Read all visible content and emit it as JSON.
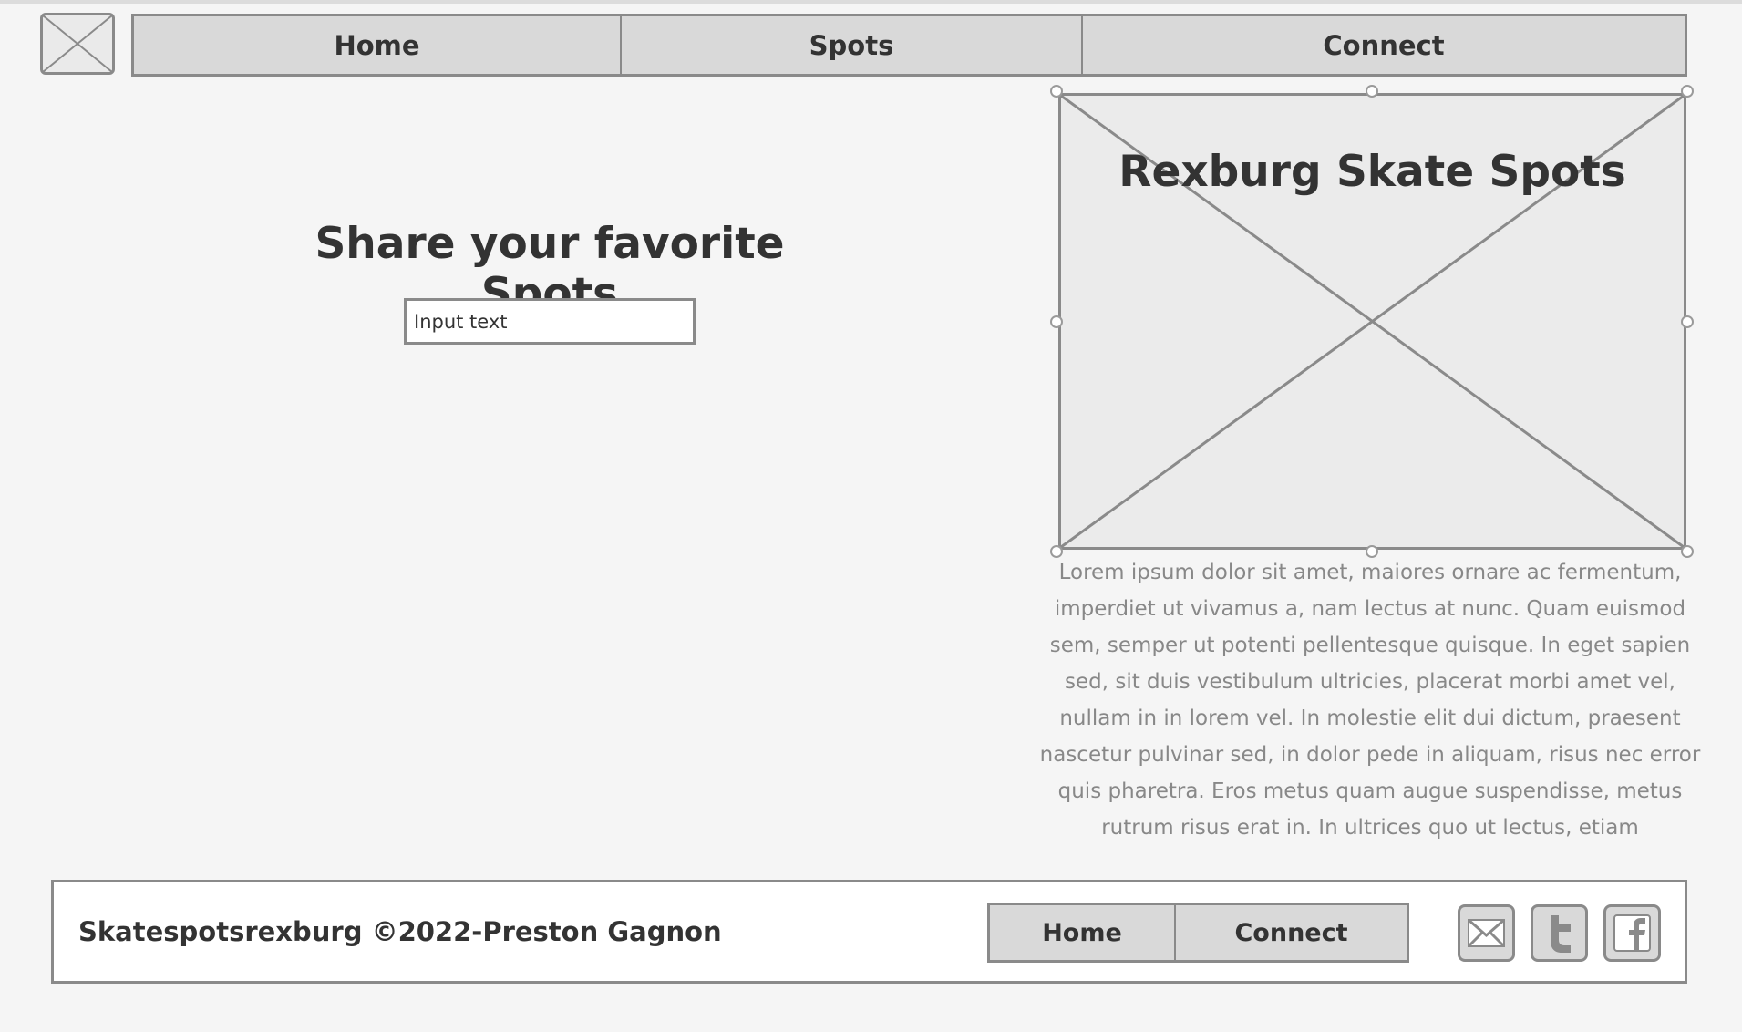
{
  "header": {
    "logo_icon": "image-placeholder-icon",
    "nav": {
      "home": "Home",
      "spots": "Spots",
      "connect": "Connect"
    }
  },
  "main": {
    "share_title": "Share your favorite Spots",
    "input_value": "Input text"
  },
  "feature": {
    "image_title": "Rexburg Skate Spots",
    "image_icon": "image-placeholder-icon",
    "body_text": "Lorem ipsum dolor sit amet, maiores ornare ac fermentum, imperdiet ut vivamus a, nam lectus at nunc. Quam euismod sem, semper ut potenti pellentesque quisque. In eget sapien sed, sit duis vestibulum ultricies, placerat morbi amet vel, nullam in in lorem vel. In molestie elit dui dictum, praesent nascetur pulvinar sed, in dolor pede in aliquam, risus nec error quis pharetra. Eros metus quam augue suspendisse, metus rutrum risus erat in.  In ultrices quo ut lectus, etiam"
  },
  "footer": {
    "copyright": "Skatespotsrexburg ©2022-Preston Gagnon",
    "nav": {
      "home": "Home",
      "connect": "Connect"
    },
    "social_icons": [
      "mail-icon",
      "twitter-icon",
      "facebook-icon"
    ]
  },
  "colors": {
    "background": "#f5f5f5",
    "border": "#8a8a8a",
    "nav_fill": "#d9d9d9",
    "text": "#333333",
    "muted_text": "#888888"
  }
}
